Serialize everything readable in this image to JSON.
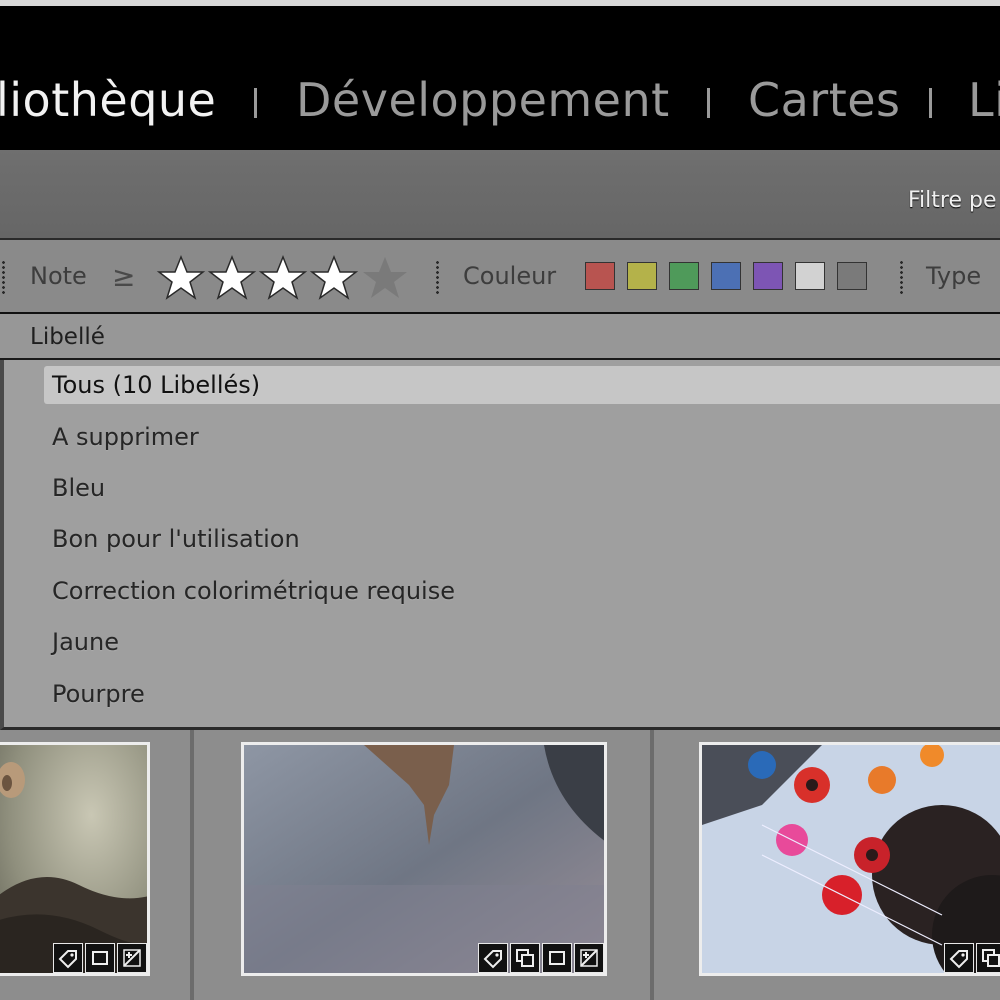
{
  "modules": {
    "library": "liothèque",
    "develop": "Développement",
    "maps": "Cartes",
    "next": "Li"
  },
  "filter_bar": {
    "title": "Filtre pe"
  },
  "attribute_bar": {
    "rating_label": "Note",
    "rating_operator": "≥",
    "rating_value": 4,
    "rating_max": 5,
    "color_label": "Couleur",
    "color_swatches": [
      "#b85450",
      "#b4b24a",
      "#4f9a5a",
      "#4c70b4",
      "#7d55b4",
      "#d2d2d2",
      "#7a7a7a"
    ],
    "type_label": "Type"
  },
  "label_panel": {
    "header": "Libellé",
    "items": [
      "Tous (10 Libellés)",
      "A supprimer",
      "Bleu",
      "Bon pour l'utilisation",
      "Correction colorimétrique requise",
      "Jaune",
      "Pourpre"
    ],
    "selected_index": 0
  },
  "thumbnails": [
    {
      "badges": [
        "keyword-tag-icon",
        "crop-icon",
        "develop-adjust-icon"
      ]
    },
    {
      "badges": [
        "keyword-tag-icon",
        "virtual-copy-icon",
        "crop-icon",
        "develop-adjust-icon"
      ]
    },
    {
      "badges": [
        "keyword-tag-icon",
        "virtual-copy-icon"
      ]
    }
  ]
}
